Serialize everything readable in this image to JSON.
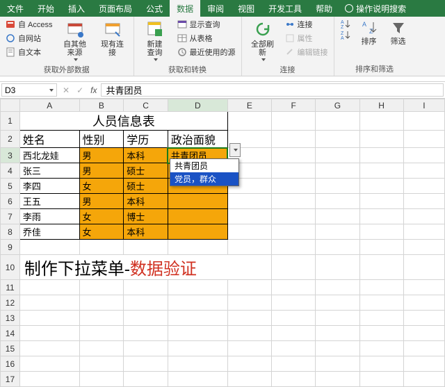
{
  "tabs": {
    "file": "文件",
    "home": "开始",
    "insert": "插入",
    "layout": "页面布局",
    "formula": "公式",
    "data": "数据",
    "review": "审阅",
    "view": "视图",
    "dev": "开发工具",
    "help": "帮助",
    "tell": "操作说明搜索"
  },
  "ribbon": {
    "ext": {
      "access": "自 Access",
      "web": "自网站",
      "text": "自文本",
      "other": "自其他来源",
      "existing": "现有连接",
      "group": "获取外部数据"
    },
    "query": {
      "new": "新建\n查询",
      "show": "显示查询",
      "table": "从表格",
      "recent": "最近使用的源",
      "group": "获取和转换"
    },
    "conn": {
      "refresh": "全部刷新",
      "connect": "连接",
      "prop": "属性",
      "editlink": "编辑链接",
      "group": "连接"
    },
    "sort": {
      "az": "A→Z",
      "za": "Z→A",
      "sort": "排序",
      "filter": "筛选",
      "group": "排序和筛选"
    }
  },
  "namebox": "D3",
  "formula": "共青团员",
  "cols": [
    "A",
    "B",
    "C",
    "D",
    "E",
    "F",
    "G",
    "H",
    "I"
  ],
  "title": "人员信息表",
  "headers": {
    "a": "姓名",
    "b": "性别",
    "c": "学历",
    "d": "政治面貌"
  },
  "rows": [
    {
      "a": "西北龙娃",
      "b": "男",
      "c": "本科",
      "d": "共青团员"
    },
    {
      "a": "张三",
      "b": "男",
      "c": "硕士",
      "d": ""
    },
    {
      "a": "李四",
      "b": "女",
      "c": "硕士",
      "d": ""
    },
    {
      "a": "王五",
      "b": "男",
      "c": "本科",
      "d": ""
    },
    {
      "a": "李雨",
      "b": "女",
      "c": "博士",
      "d": ""
    },
    {
      "a": "乔佳",
      "b": "女",
      "c": "本科",
      "d": ""
    }
  ],
  "dropdown": {
    "opt1": "共青团员",
    "opt2": "党员，群众"
  },
  "note": {
    "p1": "制作下拉菜单-",
    "p2": "数据验证"
  }
}
